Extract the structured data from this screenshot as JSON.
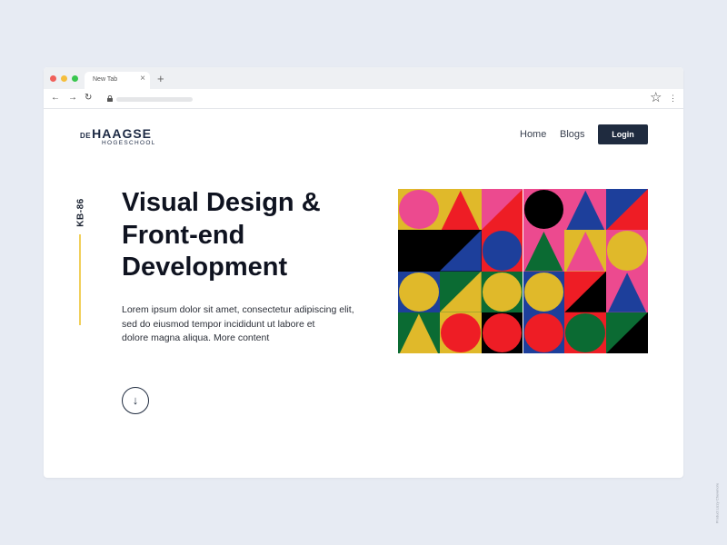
{
  "colors": {
    "page_background": "#e7ebf3",
    "navy": "#1f2b3f",
    "accent_yellow": "#f1cf5a",
    "traffic_red": "#f0605a",
    "traffic_yellow": "#f5be3c",
    "traffic_green": "#39c64e",
    "pattern": {
      "pink": "#ec4a8f",
      "yellow": "#e0b92a",
      "red": "#ee1d25",
      "black": "#000000",
      "blue": "#1d3f9b",
      "green": "#0b6b33"
    }
  },
  "browser": {
    "tab_title": "New Tab",
    "tab_close_icon": "close-icon",
    "new_tab_symbol": "+",
    "back_symbol": "←",
    "forward_symbol": "→",
    "reload_symbol": "↻",
    "star_symbol": "☆",
    "menu_symbol": "⋮"
  },
  "site": {
    "logo": {
      "prefix": "DE",
      "name": "HAAGSE",
      "subtitle": "HOGESCHOOL"
    },
    "nav": [
      {
        "label": "Home"
      },
      {
        "label": "Blogs"
      }
    ],
    "login_label": "Login"
  },
  "hero": {
    "side_label": "KB-86",
    "headline_lines": [
      "Visual Design &",
      "Front-end",
      "Development"
    ],
    "body_lines": [
      "Lorem ipsum dolor sit amet, consectetur adipiscing elit,",
      "sed do eiusmod tempor incididunt ut labore et",
      "dolore magna aliqua. More content"
    ],
    "scroll_down_icon": "arrow-down-icon",
    "scroll_down_symbol": "↓"
  },
  "pattern": {
    "rows": 4,
    "cols": 6,
    "tiles": [
      {
        "bg": "yellow",
        "shape": "circle",
        "fg": "pink"
      },
      {
        "bg": "yellow",
        "shape": "triangle",
        "fg": "red"
      },
      {
        "bg": "pink",
        "shape": "diag",
        "fg": "red"
      },
      {
        "bg": "pink",
        "shape": "circle",
        "fg": "black"
      },
      {
        "bg": "pink",
        "shape": "triangle",
        "fg": "blue"
      },
      {
        "bg": "blue",
        "shape": "diag",
        "fg": "red"
      },
      {
        "bg": "black",
        "shape": "none",
        "fg": "black"
      },
      {
        "bg": "black",
        "shape": "diag",
        "fg": "blue"
      },
      {
        "bg": "red",
        "shape": "circle",
        "fg": "blue"
      },
      {
        "bg": "pink",
        "shape": "triangle",
        "fg": "green"
      },
      {
        "bg": "yellow",
        "shape": "triangle",
        "fg": "pink"
      },
      {
        "bg": "pink",
        "shape": "circle",
        "fg": "yellow"
      },
      {
        "bg": "blue",
        "shape": "circle",
        "fg": "yellow"
      },
      {
        "bg": "green",
        "shape": "diag",
        "fg": "yellow"
      },
      {
        "bg": "green",
        "shape": "circle",
        "fg": "yellow"
      },
      {
        "bg": "blue",
        "shape": "circle",
        "fg": "yellow"
      },
      {
        "bg": "red",
        "shape": "diag",
        "fg": "black"
      },
      {
        "bg": "pink",
        "shape": "triangle",
        "fg": "blue"
      },
      {
        "bg": "green",
        "shape": "triangle",
        "fg": "yellow"
      },
      {
        "bg": "yellow",
        "shape": "circle",
        "fg": "red"
      },
      {
        "bg": "black",
        "shape": "circle",
        "fg": "red"
      },
      {
        "bg": "blue",
        "shape": "circle",
        "fg": "red"
      },
      {
        "bg": "red",
        "shape": "circle",
        "fg": "green"
      },
      {
        "bg": "green",
        "shape": "diag",
        "fg": "black"
      }
    ]
  },
  "credit_text": "Product Lizzy Chewmore"
}
